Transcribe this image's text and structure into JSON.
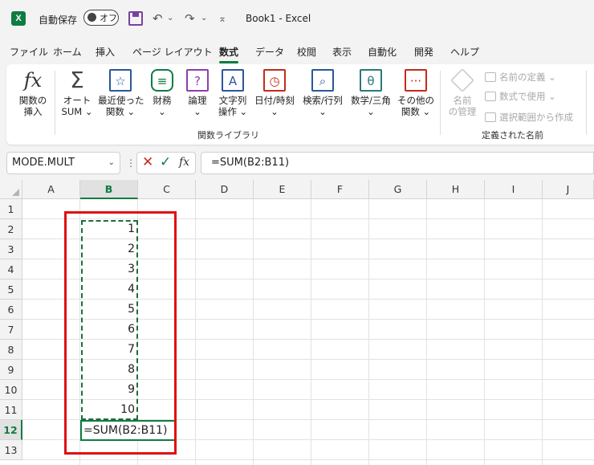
{
  "titlebar": {
    "autosave_label": "自動保存",
    "toggle_label": "オフ",
    "undo_icon": "↶",
    "redo_icon": "↷",
    "qat_more": "⌅",
    "doc_title": "Book1  -  Excel"
  },
  "menu": [
    "ファイル",
    "ホーム",
    "挿入",
    "ページ レイアウト",
    "数式",
    "データ",
    "校閲",
    "表示",
    "自動化",
    "開発",
    "ヘルプ"
  ],
  "menu_active": "数式",
  "ribbon": {
    "insert_function": [
      "関数の",
      "挿入"
    ],
    "autosum": [
      "オート",
      "SUM ⌄"
    ],
    "recent": [
      "最近使った",
      "関数 ⌄"
    ],
    "financial": [
      "財務",
      "⌄"
    ],
    "logical": [
      "論理",
      "⌄"
    ],
    "text": [
      "文字列",
      "操作 ⌄"
    ],
    "datetime": [
      "日付/時刻",
      "⌄"
    ],
    "lookup": [
      "検索/行列",
      "⌄"
    ],
    "math": [
      "数学/三角",
      "⌄"
    ],
    "other": [
      "その他の",
      "関数 ⌄"
    ],
    "group_library": "関数ライブラリ",
    "name_manager": [
      "名前",
      "の管理"
    ],
    "define_name": "名前の定義  ⌄",
    "use_in_formula": "数式で使用  ⌄",
    "create_from_selection": "選択範囲から作成",
    "group_names": "定義された名前"
  },
  "formula_bar": {
    "name_box": "MODE.MULT",
    "cancel": "✕",
    "enter": "✓",
    "fx": "fx",
    "formula": "=SUM(B2:B11)"
  },
  "columns": [
    "A",
    "B",
    "C",
    "D",
    "E",
    "F",
    "G",
    "H",
    "I",
    "J"
  ],
  "rows": [
    "1",
    "2",
    "3",
    "4",
    "5",
    "6",
    "7",
    "8",
    "9",
    "10",
    "11",
    "12",
    "13"
  ],
  "cells_b": [
    "1",
    "2",
    "3",
    "4",
    "5",
    "6",
    "7",
    "8",
    "9",
    "10"
  ],
  "active_cell_text": "=SUM(B2:B11)",
  "colors": {
    "accent": "#107c41",
    "highlight": "#e01010"
  }
}
